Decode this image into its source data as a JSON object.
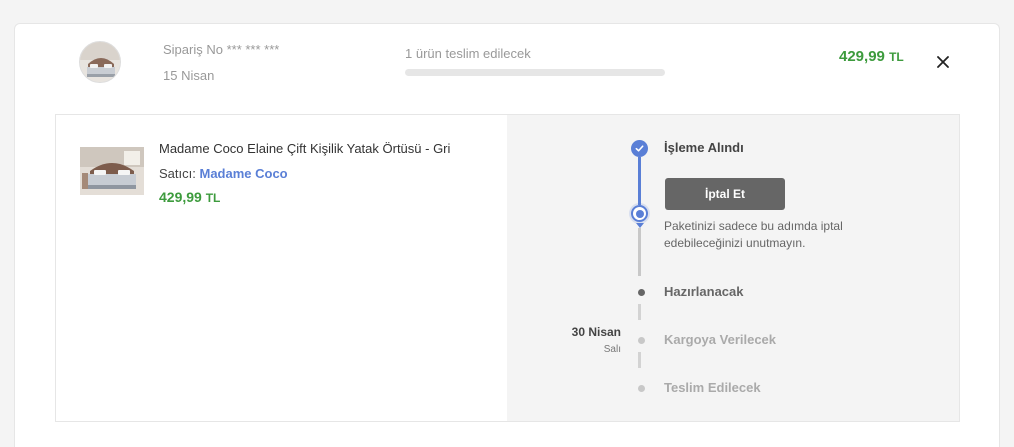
{
  "order": {
    "order_number": "Sipariş No *** *** ***",
    "date": "15 Nisan",
    "shipment_text": "1 ürün teslim edilecek",
    "progress": 0,
    "price_value": "429,99",
    "price_currency": "TL",
    "close_icon": "close-icon"
  },
  "item": {
    "name": "Madame Coco Elaine Çift Kişilik Yatak Örtüsü - Gri",
    "seller_prefix": "Satıcı:",
    "seller_name": "Madame Coco",
    "price_value": "429,99",
    "price_currency": "TL"
  },
  "timeline": {
    "steps": [
      {
        "label": "İşleme Alındı",
        "state": "done"
      },
      {
        "label": "Hazırlanacak",
        "state": "pending"
      },
      {
        "label": "Kargoya Verilecek",
        "state": "upcoming"
      },
      {
        "label": "Teslim Edilecek",
        "state": "upcoming"
      }
    ],
    "cancel_label": "İptal Et",
    "cancel_note": "Paketinizi sadece bu adımda iptal edebileceğinizi unutmayın.",
    "estimated_date": "30 Nisan",
    "estimated_day": "Salı"
  },
  "colors": {
    "accent": "#5a7fd6",
    "price": "#3d9b3d",
    "cancel_button": "#666666"
  }
}
